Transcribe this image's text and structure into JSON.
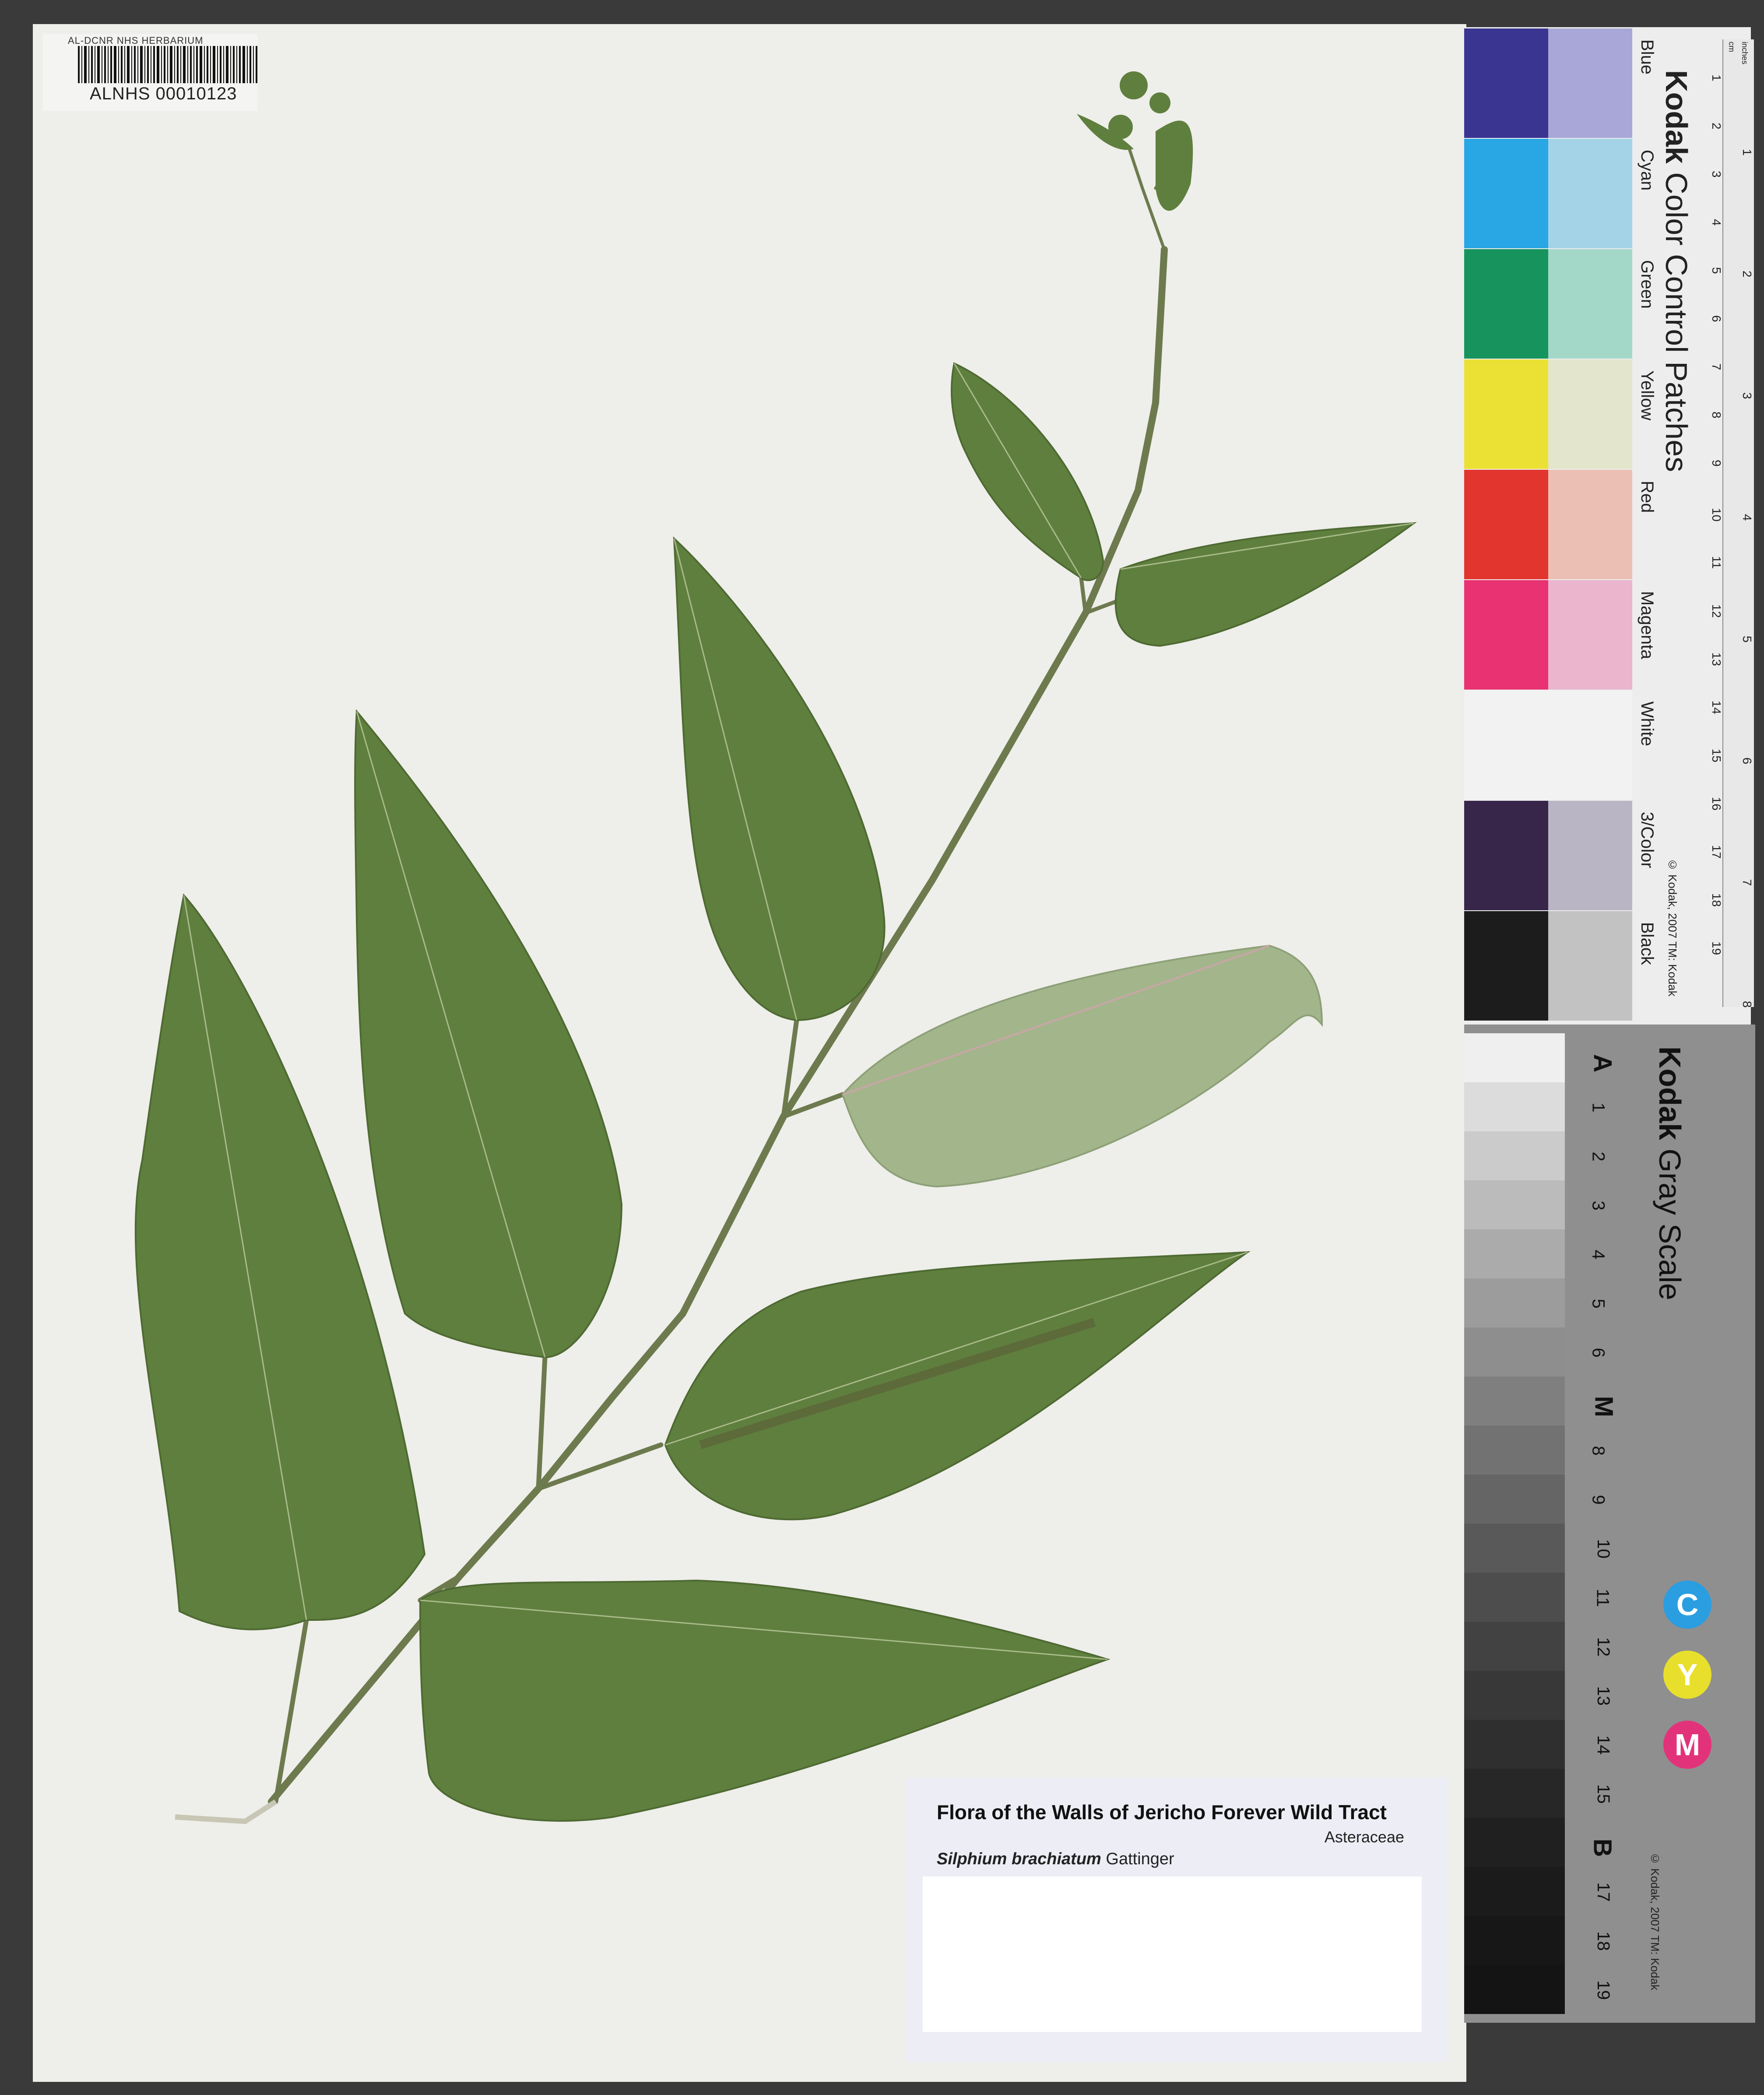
{
  "barcode": {
    "herbarium": "AL-DCNR NHS HERBARIUM",
    "number": "ALNHS 00010123"
  },
  "label": {
    "title": "Flora of the Walls of Jericho Forever Wild Tract",
    "family": "Asteraceae",
    "species_name": "Silphium brachiatum",
    "authority": "Gattinger"
  },
  "color_card": {
    "brand": "Kodak",
    "title": "Color Control Patches",
    "copyright": "© Kodak, 2007 TM: Kodak",
    "patches": [
      {
        "name": "Blue",
        "dark": "#3a3591",
        "light": "#a9a7d8"
      },
      {
        "name": "Cyan",
        "dark": "#29a6e4",
        "light": "#a4d3e8"
      },
      {
        "name": "Green",
        "dark": "#17945e",
        "light": "#a3d8c9"
      },
      {
        "name": "Yellow",
        "dark": "#eae134",
        "light": "#e3e5cc"
      },
      {
        "name": "Red",
        "dark": "#e2352e",
        "light": "#ecbfb5"
      },
      {
        "name": "Magenta",
        "dark": "#e83272",
        "light": "#eab5cd"
      },
      {
        "name": "White",
        "dark": "#f2f2f2",
        "light": "#f2f2f2"
      },
      {
        "name": "3/Color",
        "dark": "#37254a",
        "light": "#bab5c4"
      },
      {
        "name": "Black",
        "dark": "#1c1c1c",
        "light": "#c2c2c2"
      }
    ],
    "ruler_label_cm": "cm",
    "ruler_label_inches": "inches",
    "ruler_cm": [
      "1",
      "2",
      "3",
      "4",
      "5",
      "6",
      "7",
      "8",
      "9",
      "10",
      "11",
      "12",
      "13",
      "14",
      "15",
      "16",
      "17",
      "18",
      "19"
    ],
    "ruler_inches": [
      "1",
      "2",
      "3",
      "4",
      "5",
      "6",
      "7",
      "8"
    ]
  },
  "gray_card": {
    "brand": "Kodak",
    "title": "Gray Scale",
    "copyright": "© Kodak, 2007 TM: Kodak",
    "steps": [
      "A",
      "1",
      "2",
      "3",
      "4",
      "5",
      "6",
      "M",
      "8",
      "9",
      "10",
      "11",
      "12",
      "13",
      "14",
      "15",
      "B",
      "17",
      "18",
      "19"
    ],
    "shades": [
      "#efefef",
      "#dcdcdc",
      "#cbcbcb",
      "#bbbbbb",
      "#ababab",
      "#9c9c9c",
      "#8e8e8e",
      "#7f7f7f",
      "#727272",
      "#656565",
      "#595959",
      "#4d4d4d",
      "#424242",
      "#383838",
      "#2f2f2f",
      "#272727",
      "#202020",
      "#1b1b1b",
      "#171717",
      "#141414"
    ],
    "cym": [
      {
        "letter": "C",
        "color": "#2a9ee0"
      },
      {
        "letter": "Y",
        "color": "#e8df2c"
      },
      {
        "letter": "M",
        "color": "#e2337a"
      }
    ]
  }
}
